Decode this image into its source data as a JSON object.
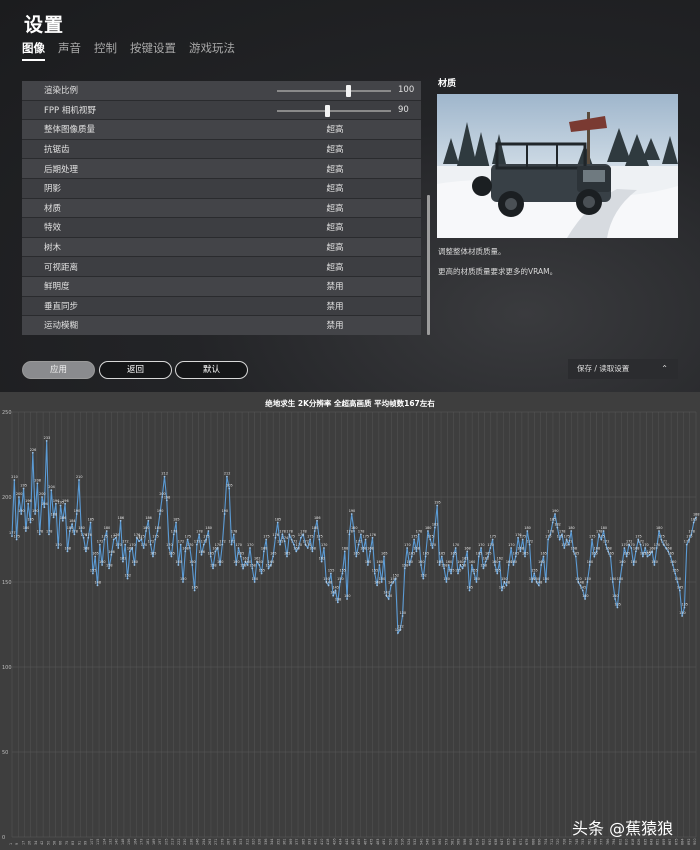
{
  "settings": {
    "title": "设置",
    "tabs": [
      "图像",
      "声音",
      "控制",
      "按键设置",
      "游戏玩法"
    ],
    "active_tab": "图像",
    "rows": [
      {
        "label": "渲染比例",
        "type": "slider",
        "value": "100",
        "fraction": 0.62
      },
      {
        "label": "FPP 相机视野",
        "type": "slider",
        "value": "90",
        "fraction": 0.44
      },
      {
        "label": "整体图像质量",
        "type": "option",
        "value": "超高"
      },
      {
        "label": "抗锯齿",
        "type": "option",
        "value": "超高"
      },
      {
        "label": "后期处理",
        "type": "option",
        "value": "超高"
      },
      {
        "label": "阴影",
        "type": "option",
        "value": "超高"
      },
      {
        "label": "材质",
        "type": "option",
        "value": "超高"
      },
      {
        "label": "特效",
        "type": "option",
        "value": "超高"
      },
      {
        "label": "树木",
        "type": "option",
        "value": "超高"
      },
      {
        "label": "可视距离",
        "type": "option",
        "value": "超高"
      },
      {
        "label": "鲜明度",
        "type": "option",
        "value": "禁用"
      },
      {
        "label": "垂直同步",
        "type": "option",
        "value": "禁用"
      },
      {
        "label": "运动模糊",
        "type": "option",
        "value": "禁用"
      }
    ],
    "detail": {
      "title": "材质",
      "desc1": "调整整体材质质量。",
      "desc2": "更高的材质质量要求更多的VRAM。"
    },
    "buttons": {
      "apply": "应用",
      "back": "返回",
      "default": "默认"
    },
    "save_load": "保存 / 读取设置"
  },
  "watermark": "头条 @蕉猿狼",
  "chart_data": {
    "type": "line",
    "title": "绝地求生 2K分辨率 全超高画质 平均帧数167左右",
    "ylim": [
      0,
      250
    ],
    "yticks": [
      0,
      50,
      100,
      150,
      200,
      250
    ],
    "xlim": [
      1,
      900
    ],
    "series_color": "#5b9bd5",
    "y": [
      177,
      210,
      175,
      200,
      190,
      205,
      180,
      196,
      185,
      226,
      190,
      208,
      178,
      200,
      194,
      233,
      178,
      204,
      188,
      196,
      170,
      195,
      186,
      196,
      168,
      180,
      184,
      178,
      190,
      210,
      180,
      176,
      168,
      176,
      185,
      155,
      165,
      148,
      172,
      160,
      175,
      180,
      158,
      166,
      175,
      176,
      170,
      186,
      162,
      172,
      152,
      168,
      170,
      160,
      176,
      174,
      175,
      170,
      180,
      186,
      172,
      165,
      175,
      180,
      190,
      200,
      212,
      198,
      170,
      165,
      178,
      185,
      160,
      172,
      150,
      168,
      175,
      170,
      160,
      145,
      172,
      178,
      166,
      172,
      175,
      180,
      165,
      158,
      168,
      170,
      160,
      172,
      190,
      212,
      205,
      172,
      178,
      160,
      170,
      165,
      158,
      162,
      160,
      170,
      158,
      150,
      162,
      160,
      155,
      168,
      175,
      158,
      160,
      165,
      176,
      185,
      172,
      178,
      174,
      165,
      178,
      175,
      172,
      168,
      170,
      176,
      178,
      172,
      170,
      175,
      168,
      180,
      186,
      175,
      162,
      170,
      150,
      148,
      155,
      142,
      145,
      138,
      150,
      155,
      168,
      140,
      178,
      190,
      180,
      165,
      172,
      178,
      168,
      175,
      160,
      168,
      176,
      155,
      148,
      160,
      150,
      165,
      142,
      140,
      148,
      150,
      152,
      120,
      122,
      130,
      158,
      170,
      160,
      165,
      175,
      168,
      178,
      160,
      152,
      165,
      180,
      175,
      170,
      182,
      195,
      160,
      165,
      158,
      150,
      160,
      155,
      165,
      170,
      155,
      160,
      158,
      162,
      168,
      145,
      160,
      155,
      150,
      165,
      170,
      158,
      162,
      165,
      170,
      175,
      160,
      155,
      162,
      145,
      150,
      148,
      160,
      170,
      160,
      165,
      176,
      168,
      175,
      165,
      180,
      172,
      150,
      155,
      150,
      148,
      160,
      165,
      150,
      175,
      178,
      185,
      190,
      182,
      175,
      178,
      170,
      175,
      172,
      180,
      168,
      165,
      150,
      148,
      145,
      140,
      150,
      160,
      175,
      165,
      168,
      178,
      175,
      180,
      172,
      168,
      165,
      150,
      140,
      135,
      150,
      160,
      170,
      165,
      172,
      170,
      160,
      168,
      175,
      172,
      165,
      170,
      165,
      166,
      168,
      160,
      170,
      180,
      175,
      172,
      170,
      168,
      165,
      160,
      155,
      150,
      145,
      130,
      135,
      172,
      175,
      178,
      185,
      188
    ]
  }
}
